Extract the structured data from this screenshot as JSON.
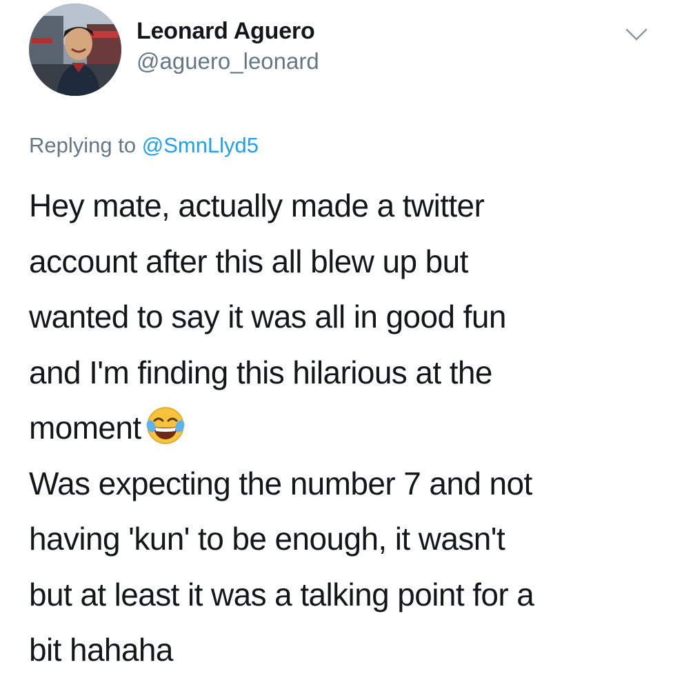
{
  "tweet": {
    "author": {
      "display_name": "Leonard Aguero",
      "handle": "@aguero_leonard",
      "avatar_icon": "profile-photo"
    },
    "menu_icon": "chevron-down-icon",
    "reply": {
      "prefix": "Replying to",
      "mention": "@SmnLlyd5"
    },
    "text_lines": [
      "Hey mate, actually made a twitter",
      "account after this all blew up but",
      "wanted to say it was all in good fun",
      "and I'm finding this hilarious at the",
      "moment",
      "Was expecting the number 7 and not",
      "having 'kun' to be enough, it wasn't",
      "but at least it was a talking point for a",
      "bit hahaha"
    ],
    "emoji": "face-with-tears-of-joy",
    "colors": {
      "link": "#1da1f2",
      "secondary": "#657786",
      "text": "#14171a"
    }
  }
}
